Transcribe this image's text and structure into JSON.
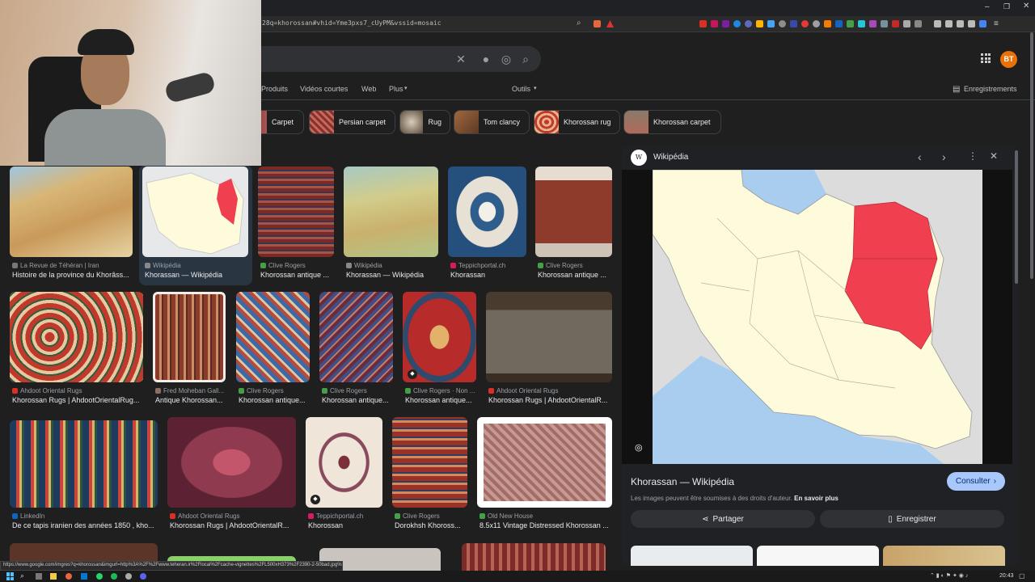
{
  "browser": {
    "url": "28q=khorossan#vhid=Yme3pxs7_cUyPM&vssid=mosaic",
    "status_url": "https://www.google.com/imgres?q=khorossan&imgurl=http%3A%2F%2Fwww.teheran.ir%2Flocal%2Fcache-vignettes%2FL500xH373%2F2390-2-50bad.jpg%3..."
  },
  "header": {
    "account_initials": "BT",
    "tabs": [
      "Produits",
      "Vidéos courtes",
      "Web",
      "Plus",
      "Outils"
    ],
    "saved_label": "Enregistrements"
  },
  "chips": [
    "Carpet",
    "Persian carpet",
    "Rug",
    "Tom clancy",
    "Khorossan rug",
    "Khorossan carpet"
  ],
  "results": [
    {
      "source": "La Revue de Téhéran | Iran",
      "title": "Histoire de la province du Khorâss..."
    },
    {
      "source": "Wikipédia",
      "title": "Khorassan — Wikipédia"
    },
    {
      "source": "Clive Rogers",
      "title": "Khorossan antique ..."
    },
    {
      "source": "Wikipédia",
      "title": "Khorassan — Wikipédia"
    },
    {
      "source": "Teppichportal.ch",
      "title": "Khorassan"
    },
    {
      "source": "Clive Rogers",
      "title": "Khorossan antique ..."
    },
    {
      "source": "Ahdoot Oriental Rugs",
      "title": "Khorossan Rugs | AhdootOrientalRug..."
    },
    {
      "source": "Fred Moheban Gall...",
      "title": "Antique Khorossan..."
    },
    {
      "source": "Clive Rogers",
      "title": "Khorossan antique..."
    },
    {
      "source": "Clive Rogers",
      "title": "Khorossan antique..."
    },
    {
      "source": "Clive Rogers · Non ...",
      "title": "Khorossan antique..."
    },
    {
      "source": "Ahdoot Oriental Rugs",
      "title": "Khorossan Rugs | AhdootOrientalR..."
    },
    {
      "source": "LinkedIn",
      "title": "De ce tapis iranien des années 1850 , kho..."
    },
    {
      "source": "Ahdoot Oriental Rugs",
      "title": "Khorossan Rugs | AhdootOrientalR..."
    },
    {
      "source": "Teppichportal.ch",
      "title": "Khorossan"
    },
    {
      "source": "Clive Rogers",
      "title": "Dorokhsh Khoross..."
    },
    {
      "source": "Old New House",
      "title": "8.5x11 Vintage Distressed Khorossan ..."
    }
  ],
  "panel": {
    "source": "Wikipédia",
    "source_icon_letter": "W",
    "title": "Khorassan — Wikipédia",
    "visit_label": "Consulter",
    "rights_text": "Les images peuvent être soumises à des droits d'auteur.",
    "learn_more": "En savoir plus",
    "share_label": "Partager",
    "save_label": "Enregistrer"
  },
  "taskbar": {
    "time": "20:43"
  },
  "colors": {
    "accent": "#a8c7fa",
    "highlight_red": "#f0404f",
    "map_land": "#fdfbdc",
    "map_sea": "#a9cdef"
  }
}
